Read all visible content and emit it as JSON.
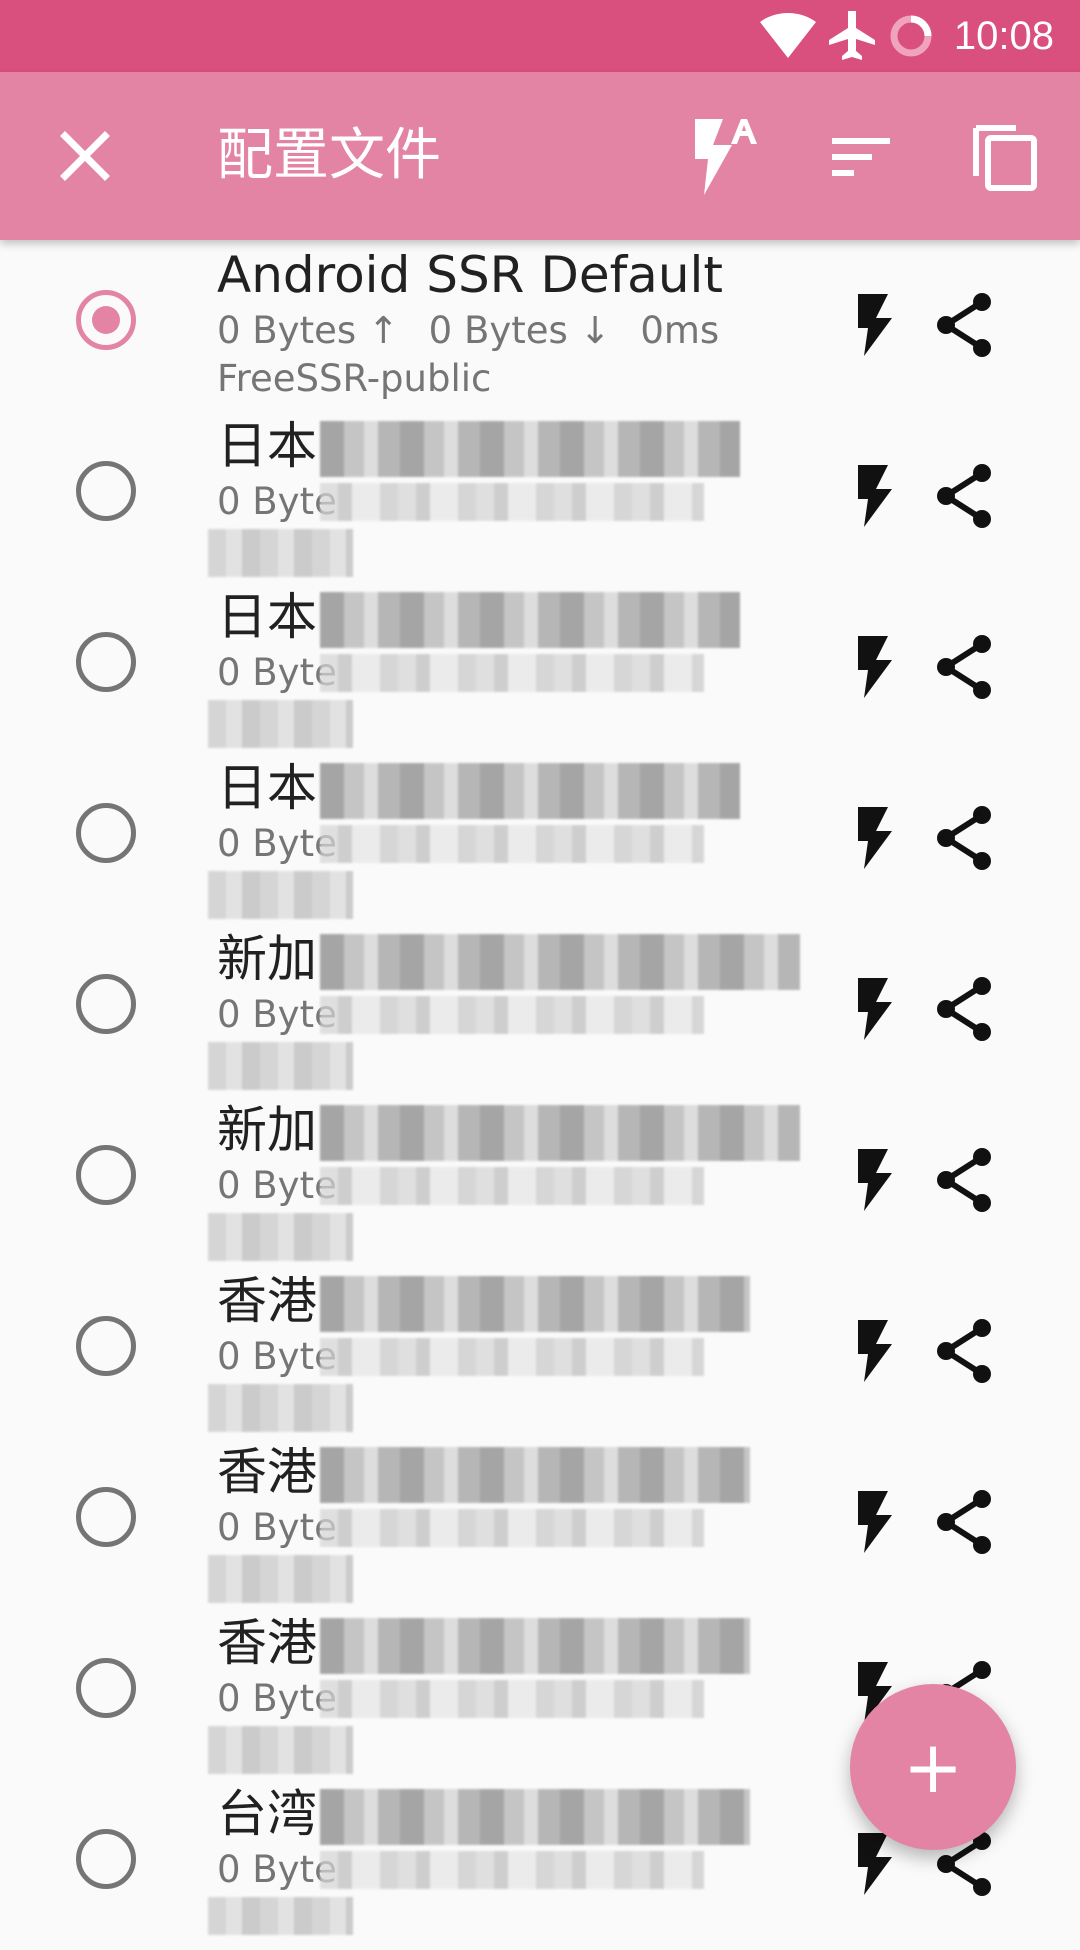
{
  "status_bar": {
    "time": "10:08",
    "icons": [
      "wifi-icon",
      "airplane-icon",
      "loading-icon"
    ]
  },
  "header": {
    "title": "配置文件",
    "close_icon": "close-icon",
    "actions": [
      "flash-auto-icon",
      "sort-icon",
      "copy-icon"
    ]
  },
  "profiles": [
    {
      "title": "Android SSR Default",
      "upload": "0 Bytes ↑",
      "download": "0 Bytes ↓",
      "latency": "0ms",
      "group": "FreeSSR-public",
      "selected": true,
      "redacted": false
    },
    {
      "title": "日本",
      "upload": "0 Byte",
      "download": "",
      "latency": "",
      "group": "",
      "selected": false,
      "redacted": true
    },
    {
      "title": "日本",
      "upload": "0 Byte",
      "download": "",
      "latency": "",
      "group": "",
      "selected": false,
      "redacted": true
    },
    {
      "title": "日本",
      "upload": "0 Byte",
      "download": "",
      "latency": "",
      "group": "",
      "selected": false,
      "redacted": true
    },
    {
      "title": "新加",
      "upload": "0 Byte",
      "download": "",
      "latency": "",
      "group": "",
      "selected": false,
      "redacted": true
    },
    {
      "title": "新加",
      "upload": "0 Byte",
      "download": "",
      "latency": "",
      "group": "",
      "selected": false,
      "redacted": true
    },
    {
      "title": "香港",
      "upload": "0 Byte",
      "download": "",
      "latency": "",
      "group": "",
      "selected": false,
      "redacted": true
    },
    {
      "title": "香港",
      "upload": "0 Byte",
      "download": "",
      "latency": "",
      "group": "",
      "selected": false,
      "redacted": true
    },
    {
      "title": "香港",
      "upload": "0 Byte",
      "download": "",
      "latency": "",
      "group": "",
      "selected": false,
      "redacted": true
    },
    {
      "title": "台湾",
      "upload": "0 Byte",
      "download": "",
      "latency": "",
      "group": "",
      "selected": false,
      "redacted": true
    }
  ],
  "fab": {
    "label": "+"
  },
  "colors": {
    "status_bar": "#d94f7e",
    "app_bar": "#e384a5",
    "background": "#fafafa",
    "text_primary": "#212121",
    "text_secondary": "#757575"
  }
}
